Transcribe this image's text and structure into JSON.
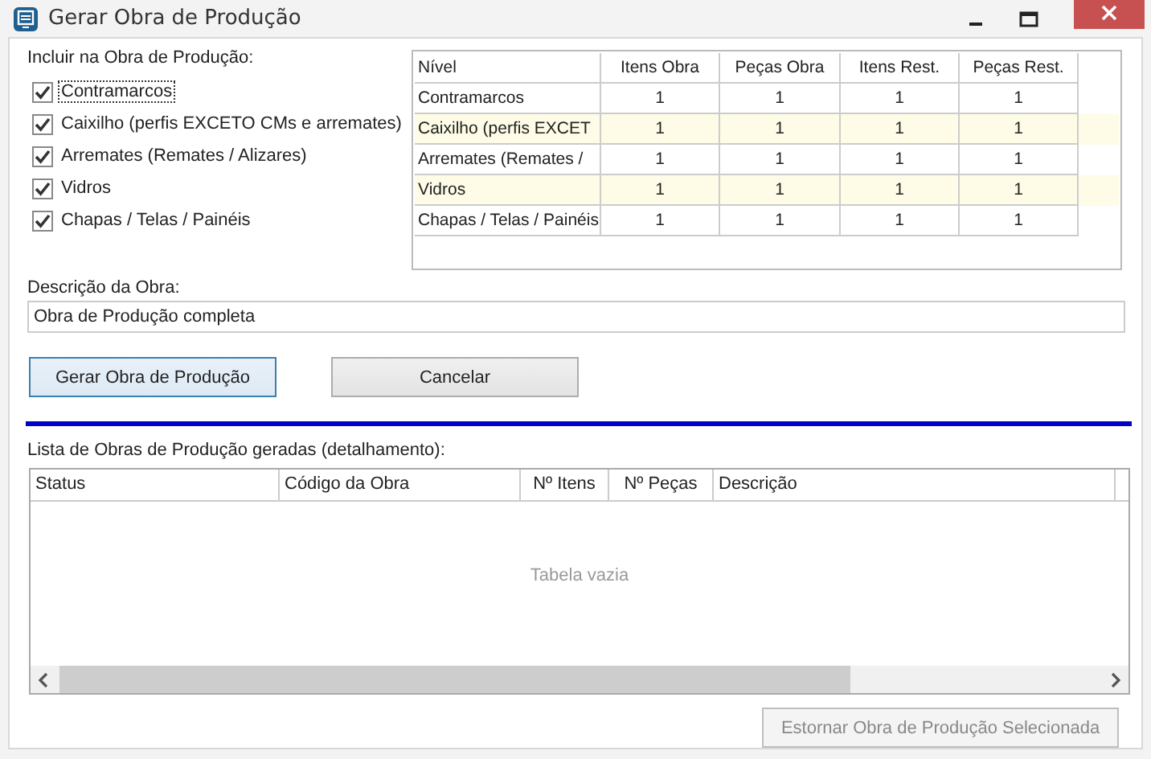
{
  "window": {
    "title": "Gerar Obra de Produção"
  },
  "include": {
    "label": "Incluir na Obra de Produção:",
    "options": [
      {
        "label": "Contramarcos",
        "checked": true,
        "focused": true
      },
      {
        "label": "Caixilho (perfis EXCETO CMs e arremates)",
        "checked": true,
        "focused": false
      },
      {
        "label": "Arremates (Remates / Alizares)",
        "checked": true,
        "focused": false
      },
      {
        "label": "Vidros",
        "checked": true,
        "focused": false
      },
      {
        "label": "Chapas / Telas / Painéis",
        "checked": true,
        "focused": false
      }
    ]
  },
  "levels_table": {
    "columns": [
      "Nível",
      "Itens Obra",
      "Peças Obra",
      "Itens Rest.",
      "Peças Rest."
    ],
    "rows": [
      [
        "Contramarcos",
        "1",
        "1",
        "1",
        "1"
      ],
      [
        "Caixilho (perfis EXCET",
        "1",
        "1",
        "1",
        "1"
      ],
      [
        "Arremates (Remates / ",
        "1",
        "1",
        "1",
        "1"
      ],
      [
        "Vidros",
        "1",
        "1",
        "1",
        "1"
      ],
      [
        "Chapas / Telas / Painéis",
        "1",
        "1",
        "1",
        "1"
      ]
    ]
  },
  "description": {
    "label": "Descrição da Obra:",
    "value": "Obra de Produção completa"
  },
  "buttons": [
    {
      "label": "Gerar Obra de Produção",
      "default": true
    },
    {
      "label": "Cancelar",
      "default": false
    }
  ],
  "list": {
    "label": "Lista de Obras de Produção geradas (detalhamento):",
    "columns": [
      "Status",
      "Código da Obra",
      "Nº Itens",
      "Nº Peças",
      "Descrição"
    ],
    "empty_text": "Tabela vazia"
  },
  "footer_button": {
    "label": "Estornar Obra de Produção Selecionada",
    "disabled": true
  }
}
